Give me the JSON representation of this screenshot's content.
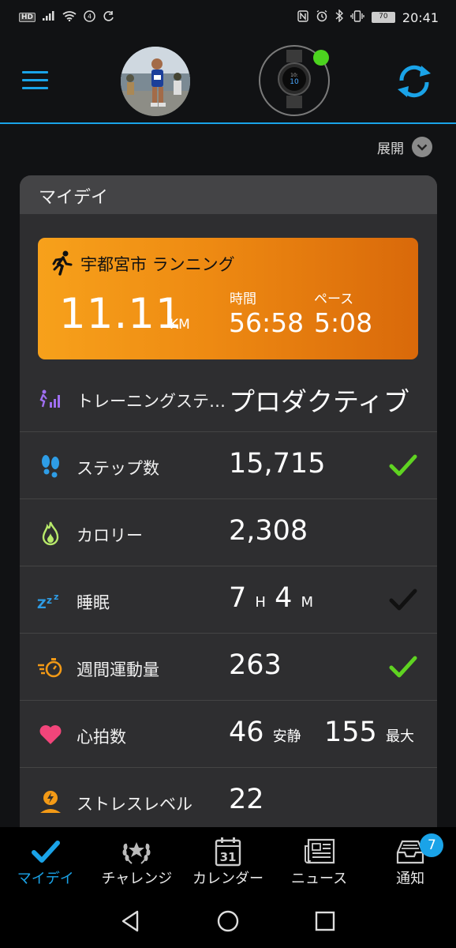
{
  "status_bar": {
    "hd": "HD",
    "battery": "70",
    "time": "20:41"
  },
  "header": {
    "menu_icon": "hamburger-icon",
    "avatar": "profile-photo",
    "device_icon": "watch-icon",
    "device_status_color": "#4cd31f",
    "sync_icon": "sync-icon"
  },
  "expand": {
    "label": "展開"
  },
  "card": {
    "title": "マイデイ",
    "activity": {
      "name": "宇都宮市 ランニング",
      "distance": "11.11",
      "unit": "KM",
      "time_label": "時間",
      "time": "56:58",
      "pace_label": "ペース",
      "pace": "5:08"
    },
    "metrics": [
      {
        "label": "トレーニングステ…",
        "value": "プロダクティブ",
        "icon": "training-status-icon"
      },
      {
        "label": "ステップ数",
        "value": "15,715",
        "icon": "footsteps-icon",
        "check": "green"
      },
      {
        "label": "カロリー",
        "value": "2,308",
        "icon": "flame-icon"
      },
      {
        "label": "睡眠",
        "value_h": "7",
        "unit_h": "H",
        "value_m": "4",
        "unit_m": "M",
        "icon": "sleep-icon",
        "check": "dark"
      },
      {
        "label": "週間運動量",
        "value": "263",
        "icon": "stopwatch-icon",
        "check": "green"
      },
      {
        "label": "心拍数",
        "value_rest": "46",
        "unit_rest": "安静",
        "value_max": "155",
        "unit_max": "最大",
        "icon": "heart-icon"
      },
      {
        "label": "ストレスレベル",
        "value": "22",
        "icon": "stress-icon"
      }
    ]
  },
  "bottom_nav": {
    "items": [
      {
        "label": "マイデイ",
        "icon": "checkmark-icon",
        "active": true
      },
      {
        "label": "チャレンジ",
        "icon": "laurel-icon"
      },
      {
        "label": "カレンダー",
        "icon": "calendar-icon",
        "calendar_day": "31"
      },
      {
        "label": "ニュース",
        "icon": "newspaper-icon"
      },
      {
        "label": "通知",
        "icon": "inbox-icon",
        "badge": "7"
      }
    ]
  },
  "colors": {
    "accent": "#1aa3e8",
    "activity_orange": "#f39a16",
    "check_green": "#5fd321"
  }
}
